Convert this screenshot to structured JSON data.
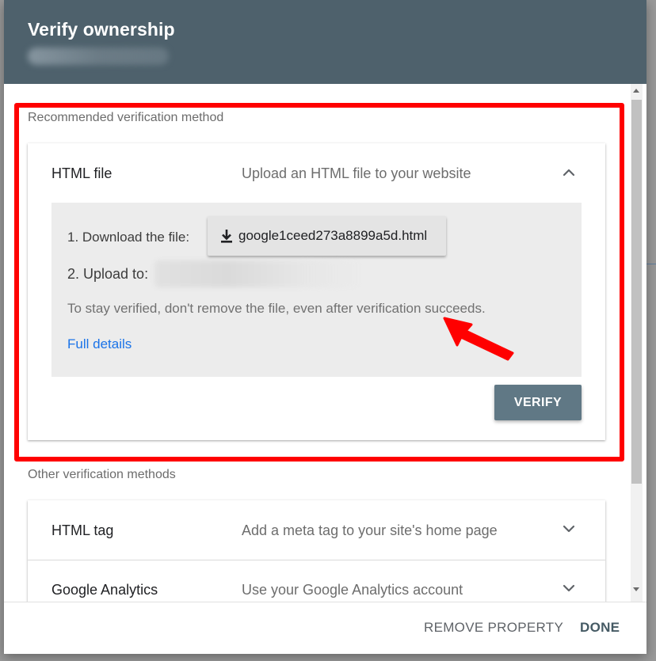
{
  "dialog": {
    "title": "Verify ownership"
  },
  "recommended": {
    "section_label": "Recommended verification method",
    "card": {
      "title": "HTML file",
      "description": "Upload an HTML file to your website",
      "step1_label": "1. Download the file:",
      "download_button_label": "google1ceed273a8899a5d.html",
      "step2_label": "2. Upload to:",
      "note": "To stay verified, don't remove the file, even after verification succeeds.",
      "details_link": "Full details",
      "verify_button_label": "VERIFY"
    }
  },
  "other": {
    "section_label": "Other verification methods",
    "methods": [
      {
        "title": "HTML tag",
        "description": "Add a meta tag to your site's home page"
      },
      {
        "title": "Google Analytics",
        "description": "Use your Google Analytics account"
      }
    ]
  },
  "footer": {
    "remove_label": "REMOVE PROPERTY",
    "done_label": "DONE"
  },
  "colors": {
    "header_bg": "#4e616c",
    "verify_bg": "#607885",
    "link": "#1a73e8",
    "annotation": "#ff0000"
  },
  "icons": {
    "download": "download-icon",
    "expand": "chevron-up-icon",
    "collapse": "chevron-down-icon"
  }
}
